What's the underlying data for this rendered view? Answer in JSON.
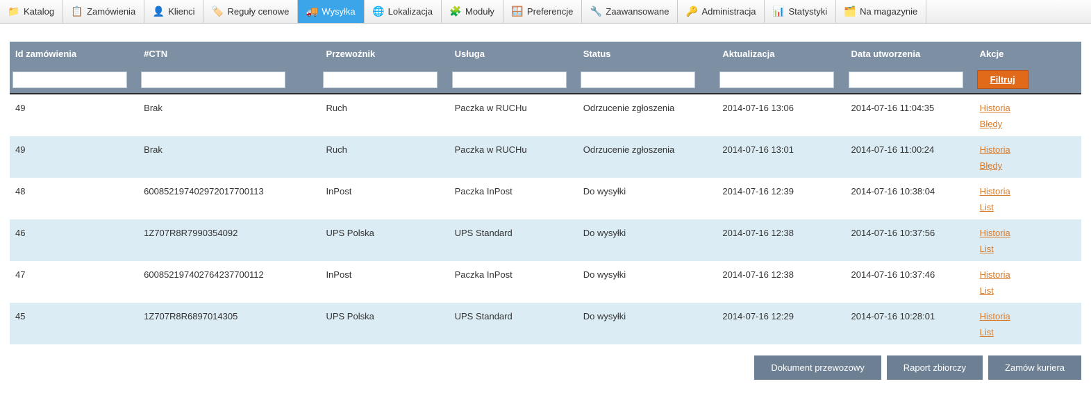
{
  "nav": [
    {
      "id": "catalog",
      "label": "Katalog",
      "icon": "📁",
      "active": false
    },
    {
      "id": "orders",
      "label": "Zamówienia",
      "icon": "📋",
      "active": false
    },
    {
      "id": "customers",
      "label": "Klienci",
      "icon": "👤",
      "active": false
    },
    {
      "id": "pricerules",
      "label": "Reguły cenowe",
      "icon": "🏷️",
      "active": false
    },
    {
      "id": "shipping",
      "label": "Wysyłka",
      "icon": "🚚",
      "active": true
    },
    {
      "id": "local",
      "label": "Lokalizacja",
      "icon": "🌐",
      "active": false
    },
    {
      "id": "modules",
      "label": "Moduły",
      "icon": "🧩",
      "active": false
    },
    {
      "id": "prefs",
      "label": "Preferencje",
      "icon": "🪟",
      "active": false
    },
    {
      "id": "advanced",
      "label": "Zaawansowane",
      "icon": "🔧",
      "active": false
    },
    {
      "id": "admin",
      "label": "Administracja",
      "icon": "🔑",
      "active": false
    },
    {
      "id": "stats",
      "label": "Statystyki",
      "icon": "📊",
      "active": false
    },
    {
      "id": "stock",
      "label": "Na magazynie",
      "icon": "🗂️",
      "active": false
    }
  ],
  "columns": {
    "id": "Id zamówienia",
    "ctn": "#CTN",
    "carrier": "Przewoźnik",
    "service": "Usługa",
    "status": "Status",
    "updated": "Aktualizacja",
    "created": "Data utworzenia",
    "actions": "Akcje"
  },
  "filter_button": "Filtruj",
  "action_labels": {
    "history": "Historia",
    "errors": "Błędy",
    "list": "List"
  },
  "rows": [
    {
      "id": "49",
      "ctn": "Brak",
      "carrier": "Ruch",
      "service": "Paczka w RUCHu",
      "status": "Odrzucenie zgłoszenia",
      "updated": "2014-07-16 13:06",
      "created": "2014-07-16 11:04:35",
      "actions": [
        "history",
        "errors"
      ]
    },
    {
      "id": "49",
      "ctn": "Brak",
      "carrier": "Ruch",
      "service": "Paczka w RUCHu",
      "status": "Odrzucenie zgłoszenia",
      "updated": "2014-07-16 13:01",
      "created": "2014-07-16 11:00:24",
      "actions": [
        "history",
        "errors"
      ]
    },
    {
      "id": "48",
      "ctn": "600852197402972017700113",
      "carrier": "InPost",
      "service": "Paczka InPost",
      "status": "Do wysyłki",
      "updated": "2014-07-16 12:39",
      "created": "2014-07-16 10:38:04",
      "actions": [
        "history",
        "list"
      ]
    },
    {
      "id": "46",
      "ctn": "1Z707R8R7990354092",
      "carrier": "UPS Polska",
      "service": "UPS Standard",
      "status": "Do wysyłki",
      "updated": "2014-07-16 12:38",
      "created": "2014-07-16 10:37:56",
      "actions": [
        "history",
        "list"
      ]
    },
    {
      "id": "47",
      "ctn": "600852197402764237700112",
      "carrier": "InPost",
      "service": "Paczka InPost",
      "status": "Do wysyłki",
      "updated": "2014-07-16 12:38",
      "created": "2014-07-16 10:37:46",
      "actions": [
        "history",
        "list"
      ]
    },
    {
      "id": "45",
      "ctn": "1Z707R8R6897014305",
      "carrier": "UPS Polska",
      "service": "UPS Standard",
      "status": "Do wysyłki",
      "updated": "2014-07-16 12:29",
      "created": "2014-07-16 10:28:01",
      "actions": [
        "history",
        "list"
      ]
    }
  ],
  "footer_buttons": {
    "waybill": "Dokument przewozowy",
    "report": "Raport zbiorczy",
    "courier": "Zamów kuriera"
  }
}
